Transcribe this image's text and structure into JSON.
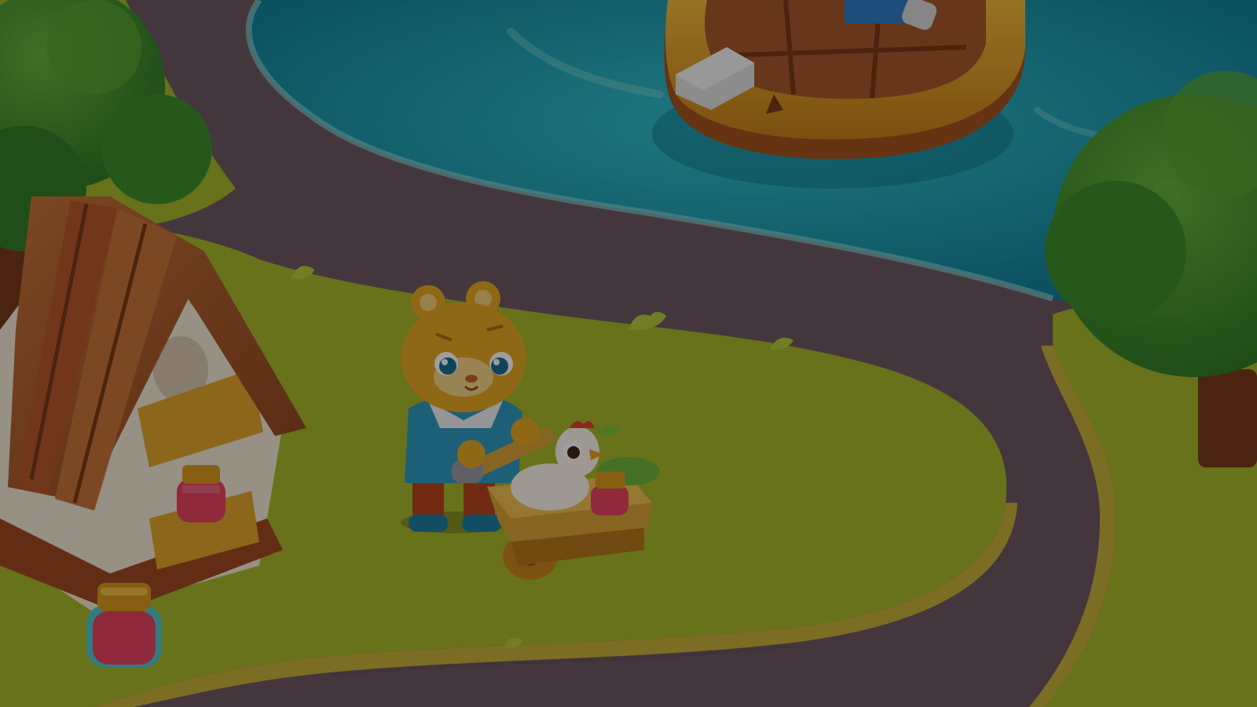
{
  "scene": {
    "colors": {
      "water": "#1ea6b8",
      "water_deep": "#0f7a95",
      "grass": "#a6b92a",
      "grass_edge": "#c9c13a",
      "path": "#6d5a63",
      "wood": "#b8632e",
      "boat": "#e3a52a",
      "tree": "#3f8f2d",
      "overlay": "rgba(0,0,0,0.38)"
    },
    "objects": {
      "boat": "rowboat",
      "house": "wooden-hut",
      "character": "tiger-cub",
      "companion": "chick",
      "cart": "wheelbarrow",
      "jam_jars": 3,
      "trees": 2
    }
  }
}
